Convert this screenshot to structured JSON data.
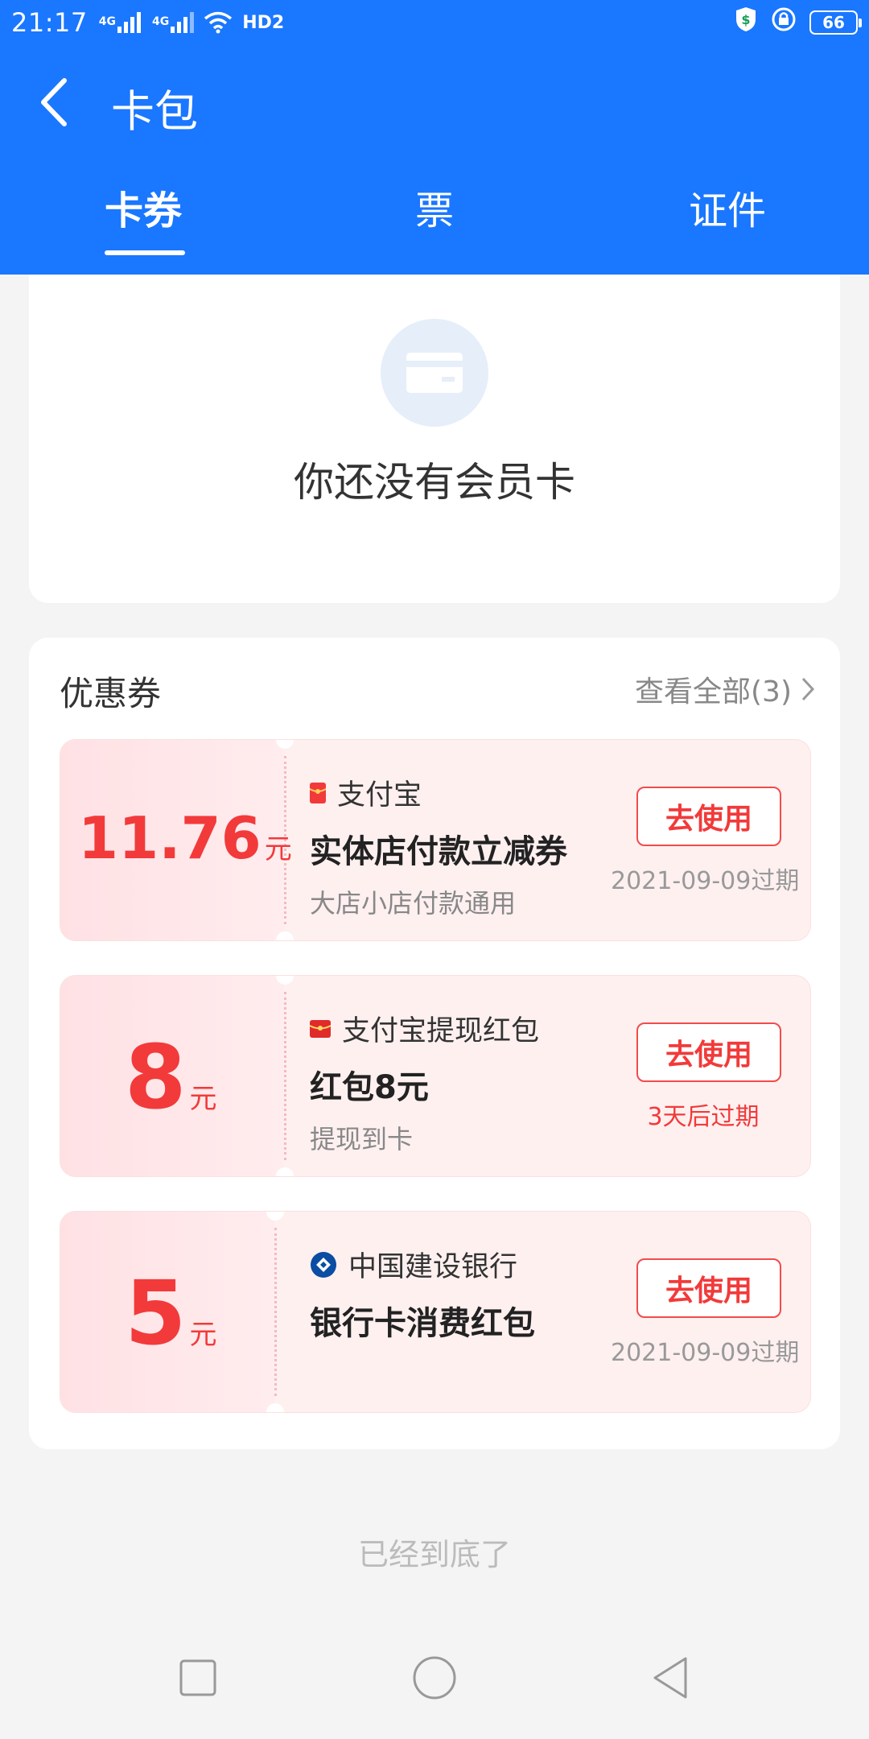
{
  "status_bar": {
    "time": "21:17",
    "network_1": "4G",
    "network_2": "4G",
    "hd_label": "HD2",
    "battery": "66"
  },
  "header": {
    "title": "卡包",
    "tabs": [
      {
        "label": "卡券",
        "active": true
      },
      {
        "label": "票",
        "active": false
      },
      {
        "label": "证件",
        "active": false
      }
    ]
  },
  "member_card": {
    "empty_text": "你还没有会员卡"
  },
  "coupons_section": {
    "title": "优惠券",
    "view_all": "查看全部(3)",
    "items": [
      {
        "amount": "11.76",
        "unit": "元",
        "brand": "支付宝",
        "brand_icon": "red-envelope-icon",
        "title": "实体店付款立减券",
        "desc": "大店小店付款通用",
        "button": "去使用",
        "expire": "2021-09-09过期"
      },
      {
        "amount": "8",
        "unit": "元",
        "brand": "支付宝提现红包",
        "brand_icon": "red-envelope-icon",
        "title": "红包8元",
        "desc": "提现到卡",
        "button": "去使用",
        "expire": "3天后过期"
      },
      {
        "amount": "5",
        "unit": "元",
        "brand": "中国建设银行",
        "brand_icon": "ccb-logo-icon",
        "title": "银行卡消费红包",
        "desc": "",
        "button": "去使用",
        "expire": "2021-09-09过期"
      }
    ]
  },
  "footer": {
    "end_text": "已经到底了"
  },
  "colors": {
    "primary": "#1a77ff",
    "accent_red": "#f23a3a",
    "coupon_bg": "#fff0f0"
  }
}
